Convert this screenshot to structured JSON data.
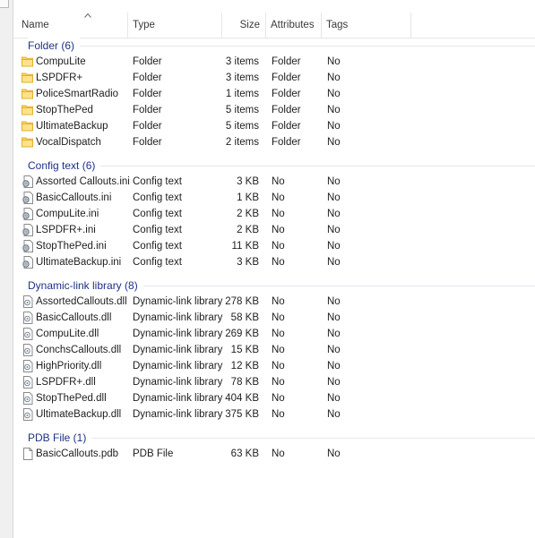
{
  "columns": {
    "name": "Name",
    "type": "Type",
    "size": "Size",
    "attributes": "Attributes",
    "tags": "Tags"
  },
  "groups": [
    {
      "title": "Folder (6)",
      "icon": "folder-icon",
      "items": [
        {
          "name": "CompuLite",
          "type": "Folder",
          "size": "3 items",
          "attributes": "Folder",
          "tags": "No"
        },
        {
          "name": "LSPDFR+",
          "type": "Folder",
          "size": "3 items",
          "attributes": "Folder",
          "tags": "No"
        },
        {
          "name": "PoliceSmartRadio",
          "type": "Folder",
          "size": "1 items",
          "attributes": "Folder",
          "tags": "No"
        },
        {
          "name": "StopThePed",
          "type": "Folder",
          "size": "5 items",
          "attributes": "Folder",
          "tags": "No"
        },
        {
          "name": "UltimateBackup",
          "type": "Folder",
          "size": "5 items",
          "attributes": "Folder",
          "tags": "No"
        },
        {
          "name": "VocalDispatch",
          "type": "Folder",
          "size": "2 items",
          "attributes": "Folder",
          "tags": "No"
        }
      ]
    },
    {
      "title": "Config text (6)",
      "icon": "config-file-icon",
      "items": [
        {
          "name": "Assorted Callouts.ini",
          "type": "Config text",
          "size": "3 KB",
          "attributes": "No",
          "tags": "No"
        },
        {
          "name": "BasicCallouts.ini",
          "type": "Config text",
          "size": "1 KB",
          "attributes": "No",
          "tags": "No"
        },
        {
          "name": "CompuLite.ini",
          "type": "Config text",
          "size": "2 KB",
          "attributes": "No",
          "tags": "No"
        },
        {
          "name": "LSPDFR+.ini",
          "type": "Config text",
          "size": "2 KB",
          "attributes": "No",
          "tags": "No"
        },
        {
          "name": "StopThePed.ini",
          "type": "Config text",
          "size": "11 KB",
          "attributes": "No",
          "tags": "No"
        },
        {
          "name": "UltimateBackup.ini",
          "type": "Config text",
          "size": "3 KB",
          "attributes": "No",
          "tags": "No"
        }
      ]
    },
    {
      "title": "Dynamic-link library (8)",
      "icon": "dll-file-icon",
      "items": [
        {
          "name": "AssortedCallouts.dll",
          "type": "Dynamic-link library",
          "size": "278 KB",
          "attributes": "No",
          "tags": "No"
        },
        {
          "name": "BasicCallouts.dll",
          "type": "Dynamic-link library",
          "size": "58 KB",
          "attributes": "No",
          "tags": "No"
        },
        {
          "name": "CompuLite.dll",
          "type": "Dynamic-link library",
          "size": "269 KB",
          "attributes": "No",
          "tags": "No"
        },
        {
          "name": "ConchsCallouts.dll",
          "type": "Dynamic-link library",
          "size": "15 KB",
          "attributes": "No",
          "tags": "No"
        },
        {
          "name": "HighPriority.dll",
          "type": "Dynamic-link library",
          "size": "12 KB",
          "attributes": "No",
          "tags": "No"
        },
        {
          "name": "LSPDFR+.dll",
          "type": "Dynamic-link library",
          "size": "78 KB",
          "attributes": "No",
          "tags": "No"
        },
        {
          "name": "StopThePed.dll",
          "type": "Dynamic-link library",
          "size": "404 KB",
          "attributes": "No",
          "tags": "No"
        },
        {
          "name": "UltimateBackup.dll",
          "type": "Dynamic-link library",
          "size": "375 KB",
          "attributes": "No",
          "tags": "No"
        }
      ]
    },
    {
      "title": "PDB File (1)",
      "icon": "blank-file-icon",
      "items": [
        {
          "name": "BasicCallouts.pdb",
          "type": "PDB File",
          "size": "63 KB",
          "attributes": "No",
          "tags": "No"
        }
      ]
    }
  ],
  "colors": {
    "group_header": "#1e3287",
    "folder_fill": "#ffd766",
    "folder_edge": "#e0b030"
  }
}
